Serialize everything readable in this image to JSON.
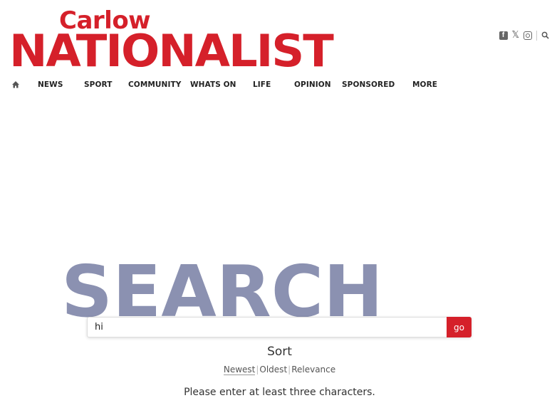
{
  "brand": {
    "logo_top": "Carlow",
    "logo_main": "NATIONALIST",
    "accent_color": "#d5202a"
  },
  "social": {
    "icons": [
      "facebook-icon",
      "x-icon",
      "instagram-icon",
      "search-icon"
    ]
  },
  "nav": {
    "home_icon": "home-icon",
    "items": [
      "NEWS",
      "SPORT",
      "COMMUNITY",
      "WHATS ON",
      "LIFE",
      "OPINION",
      "SPONSORED",
      "MORE"
    ]
  },
  "search": {
    "heading": "SEARCH",
    "input_value": "hi",
    "go_label": "go",
    "heading_color": "#8b91b1"
  },
  "sort": {
    "title": "Sort",
    "options": [
      "Newest",
      "Oldest",
      "Relevance"
    ]
  },
  "message": "Please enter at least three characters."
}
